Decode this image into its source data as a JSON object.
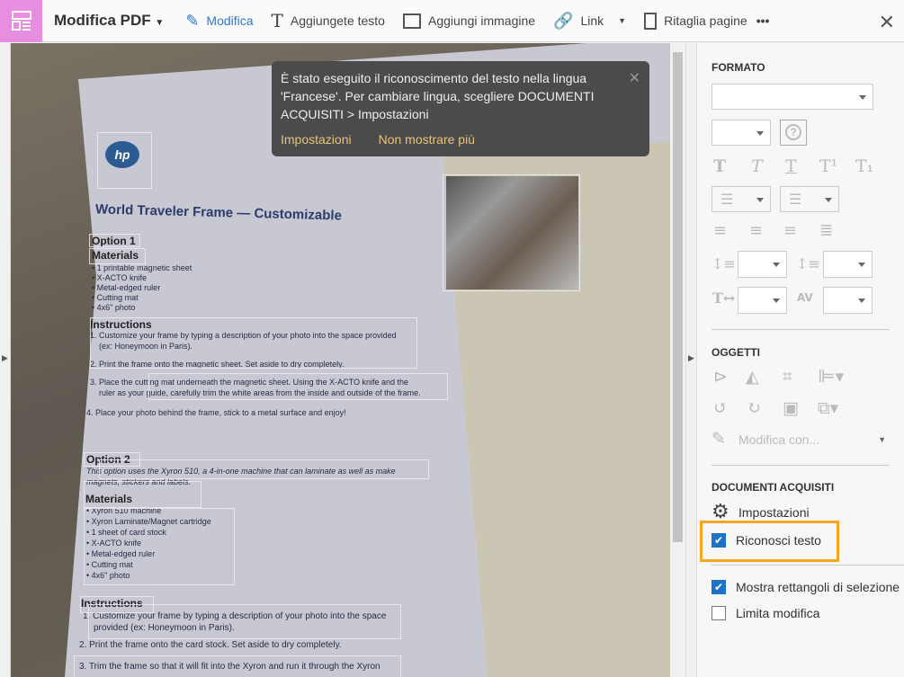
{
  "toolbar": {
    "title": "Modifica PDF",
    "items": [
      {
        "label": "Modifica",
        "icon": "edit-icon",
        "active": true
      },
      {
        "label": "Aggiungete testo",
        "icon": "text-icon"
      },
      {
        "label": "Aggiungi immagine",
        "icon": "image-icon"
      },
      {
        "label": "Link",
        "icon": "link-icon"
      },
      {
        "label": "Ritaglia pagine",
        "icon": "crop-pages-icon"
      }
    ],
    "more": "•••",
    "close": "✕"
  },
  "toast": {
    "message": "È stato eseguito il riconoscimento del testo nella lingua 'Francese'. Per cambiare lingua, scegliere DOCUMENTI ACQUISITI > Impostazioni",
    "link_settings": "Impostazioni",
    "link_dismiss": "Non mostrare più",
    "close": "✕"
  },
  "document": {
    "logo": "hp invent",
    "title": "World Traveler Frame — Customizable",
    "option1": "Option 1",
    "materials1": "Materials",
    "m1": [
      "• 1 printable magnetic sheet",
      "• X-ACTO knife",
      "• Metal-edged ruler",
      "• Cutting mat",
      "• 4x6\" photo"
    ],
    "instructions1": "Instructions",
    "i1": [
      "1. Customize your frame by typing a description of your photo into the space provided",
      "(ex: Honeymoon in Paris).",
      "2. Print the frame onto the magnetic sheet. Set aside to dry completely.",
      "3. Place the cutting mat underneath the magnetic sheet. Using the X-ACTO knife and the",
      "ruler as your guide, carefully trim the white areas from the inside and outside of the frame.",
      "4. Place your photo behind the frame, stick to a metal surface and enjoy!"
    ],
    "option2": "Option 2",
    "o2desc": [
      "This option uses the Xyron 510, a 4-in-one machine that can laminate as well as make",
      "magnets, stickers and labels."
    ],
    "materials2": "Materials",
    "m2": [
      "• Xyron 510 machine",
      "• Xyron Laminate/Magnet cartridge",
      "• 1 sheet of card stock",
      "• X-ACTO knife",
      "• Metal-edged ruler",
      "• Cutting mat",
      "• 4x6\" photo"
    ],
    "instructions2": "Instructions",
    "i2": [
      "1. Customize your frame by typing a description of your photo into the space",
      "provided (ex: Honeymoon in Paris).",
      "2. Print the frame onto the card stock. Set aside to dry completely.",
      "3. Trim the frame so that it will fit into the Xyron and run it through the Xyron"
    ]
  },
  "panel": {
    "formato": "FORMATO",
    "format_icons": [
      "T",
      "T",
      "T",
      "T¹",
      "T₁"
    ],
    "oggetti": "OGGETTI",
    "modifica_con": "Modifica con...",
    "documenti": "DOCUMENTI ACQUISITI",
    "impostazioni": "Impostazioni",
    "riconosci": {
      "label": "Riconosci testo",
      "checked": true
    },
    "mostra": {
      "label": "Mostra rettangoli di selezione",
      "checked": true
    },
    "limita": {
      "label": "Limita modifica",
      "checked": false
    },
    "help": "?",
    "check": "✔"
  },
  "colors": {
    "accent": "#2d79d0",
    "highlight": "#f5a623",
    "app_icon": "#e88ee0",
    "toast_link": "#e8c37a"
  }
}
